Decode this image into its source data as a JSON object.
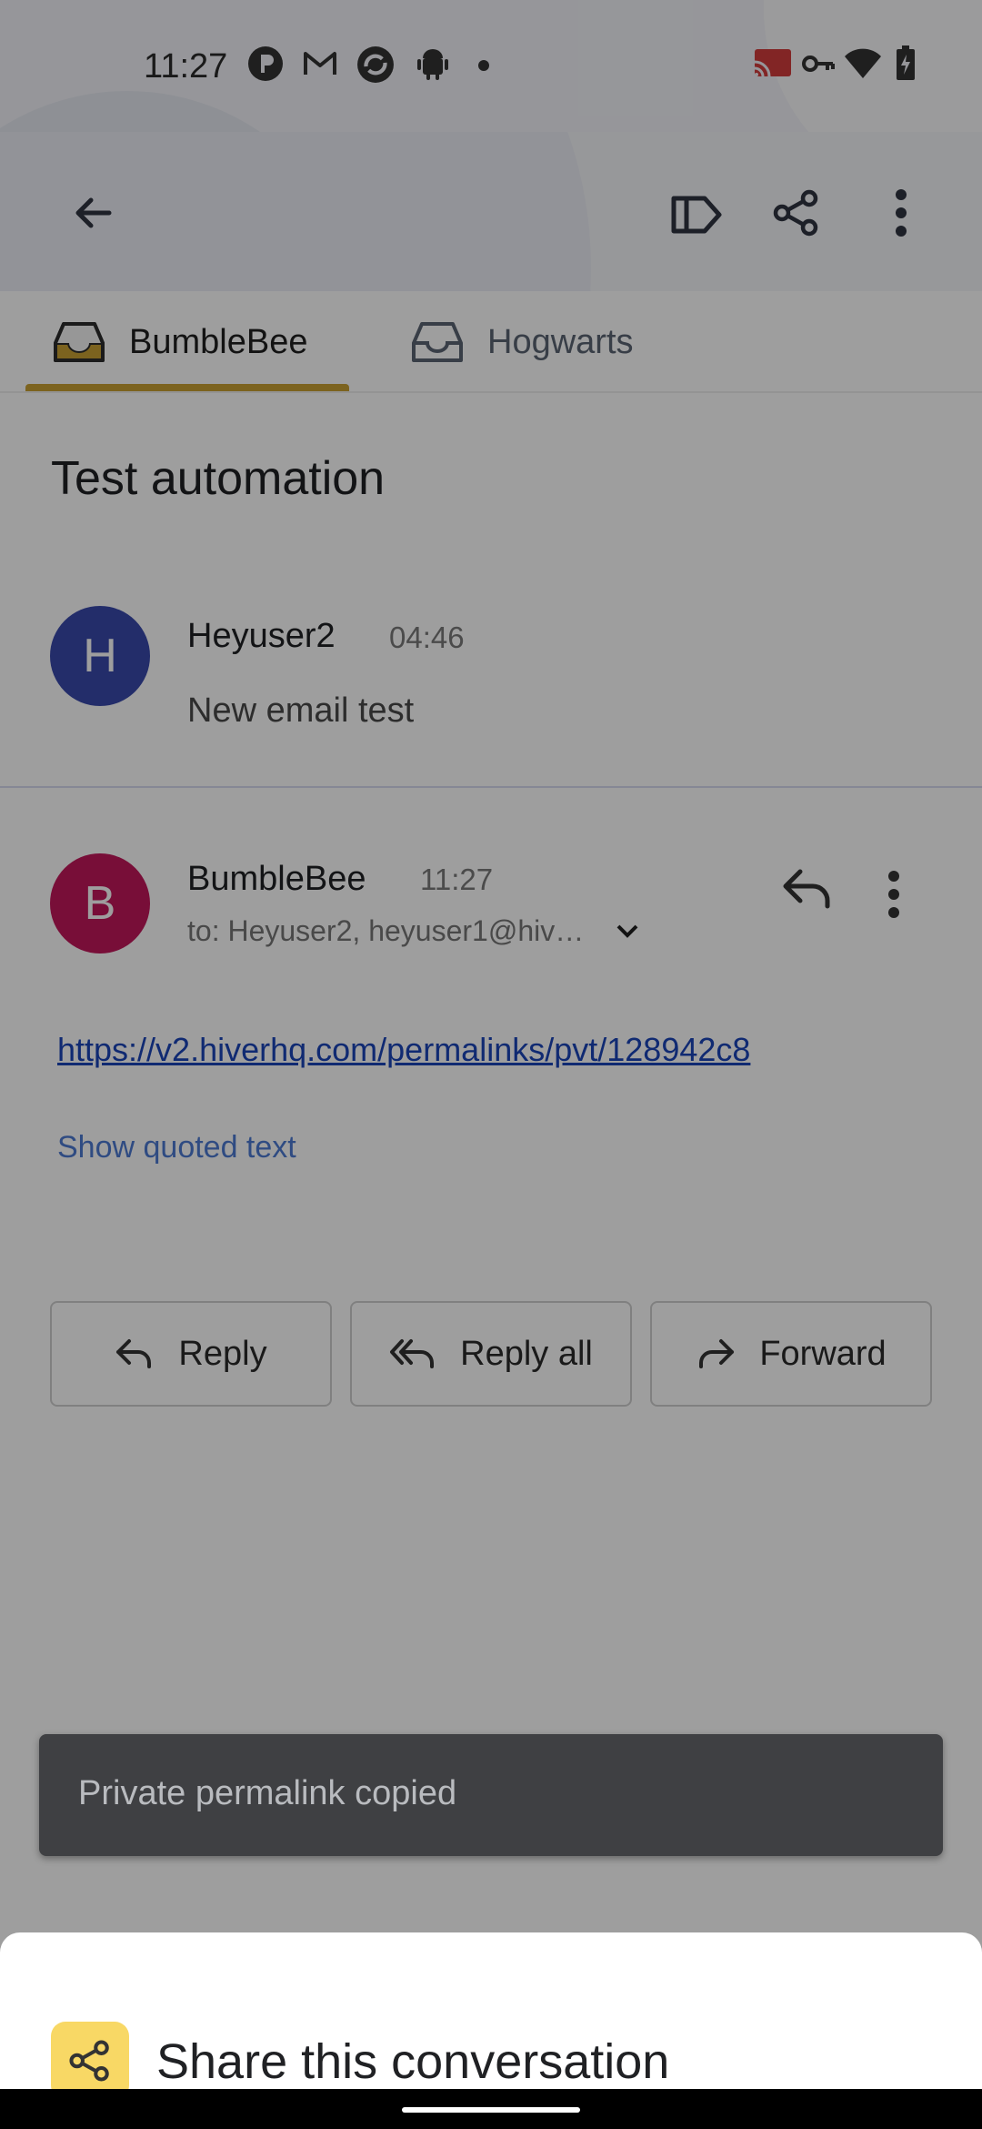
{
  "status_bar": {
    "time": "11:27",
    "left_icons": [
      "p-app-icon",
      "gmail-icon",
      "sync-app-icon",
      "android-icon",
      "dot-icon"
    ],
    "right_icons": [
      "cast-icon",
      "vpn-key-icon",
      "wifi-icon",
      "battery-charging-icon"
    ]
  },
  "app_bar": {
    "icons": [
      "back-arrow-icon",
      "label-icon",
      "share-icon",
      "more-vert-icon"
    ]
  },
  "tabs": [
    {
      "label": "BumbleBee",
      "active": true
    },
    {
      "label": "Hogwarts",
      "active": false
    }
  ],
  "colors": {
    "accent": "#c9a132",
    "avatar_h": "#3949ab",
    "avatar_b": "#c2185b",
    "link": "#1a44b8",
    "sheet_icon_bg": "#f8d865"
  },
  "conversation": {
    "subject": "Test automation",
    "messages": [
      {
        "avatar": "H",
        "sender": "Heyuser2",
        "time": "04:46",
        "snippet": "New email test"
      },
      {
        "avatar": "B",
        "sender": "BumbleBee",
        "time": "11:27",
        "recipients": "to: Heyuser2, heyuser1@hiv…",
        "link": "https://v2.hiverhq.com/permalinks/pvt/128942c8",
        "show_quoted": "Show quoted text"
      }
    ]
  },
  "actions": {
    "reply": "Reply",
    "reply_all": "Reply all",
    "forward": "Forward"
  },
  "snackbar": {
    "text": "Private permalink copied"
  },
  "sheet": {
    "title": "Share this conversation"
  }
}
